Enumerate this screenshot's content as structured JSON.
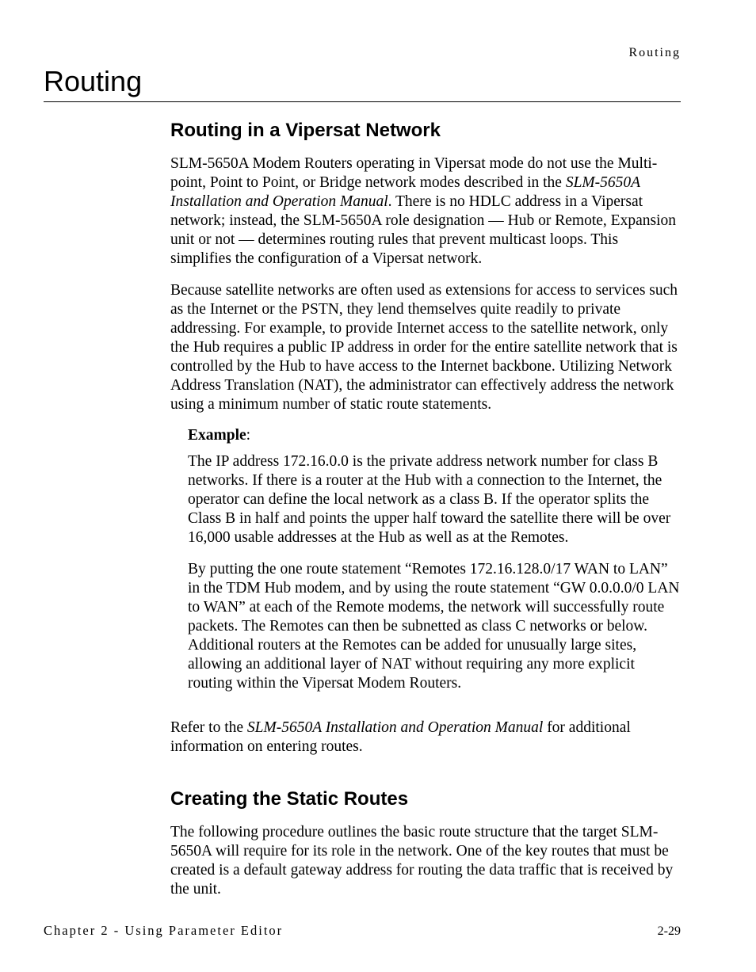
{
  "running_head": "Routing",
  "section_title": "Routing",
  "h2_1": "Routing in a Vipersat Network",
  "p1_a": "SLM-5650A Modem Routers operating in Vipersat mode do not use the Multi-point, Point to Point, or Bridge network modes described in the ",
  "p1_i1": "SLM-5650A Installation and Operation Manual",
  "p1_b": ". There is no HDLC address in a Vipersat network; instead, the SLM-5650A role designation — Hub or Remote, Expansion unit or not — determines routing rules that prevent multicast loops. This simplifies the configuration of a Vipersat network.",
  "p2": "Because satellite networks are often used as extensions for access to services such as the Internet or the PSTN, they lend themselves quite readily to private addressing. For example, to provide Internet access to the satellite network, only the Hub requires a public IP address in order for the entire satellite network that is controlled by the Hub to have access to the Internet backbone. Utilizing Network Address Translation (NAT), the administrator can effectively address the network using a minimum number of static route statements.",
  "example_label": "Example",
  "example_colon": ":",
  "ex_p1": "The IP address 172.16.0.0 is the private address network number for class B networks. If there is a router at the Hub with a connection to the Internet, the operator can define the local network as a class B. If the operator splits the Class B in half and points the upper half toward the satellite there will be over 16,000 usable addresses at the Hub as well as at the Remotes.",
  "ex_p2": "By putting the one route statement “Remotes 172.16.128.0/17 WAN to LAN” in the TDM Hub modem, and by using the route statement “GW 0.0.0.0/0 LAN to WAN” at each of the Remote modems, the network will successfully route packets. The Remotes can then be subnetted as class C networks or below. Additional routers at the Remotes can be added for unusually large sites, allowing an additional layer of NAT without requiring any more explicit routing within the Vipersat Modem Routers.",
  "p3_a": "Refer to the ",
  "p3_i": "SLM-5650A Installation and Operation Manual",
  "p3_b": " for additional information on entering routes.",
  "h2_2": "Creating the Static Routes",
  "p4": "The following procedure outlines the basic route structure that the target SLM-5650A will require for its role in the network. One of the key routes that must be created is a default gateway address for routing the data traffic that is received by the unit.",
  "footer_left": "Chapter 2 - Using Parameter Editor",
  "footer_right": "2-29"
}
